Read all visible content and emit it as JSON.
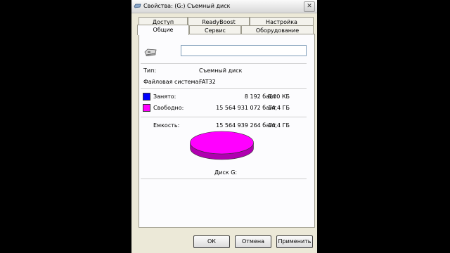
{
  "window": {
    "title": "Свойства: (G:) Съемный диск"
  },
  "tabs_back": [
    "Доступ",
    "ReadyBoost",
    "Настройка"
  ],
  "tabs_front": [
    "Общие",
    "Сервис",
    "Оборудование"
  ],
  "volume_label": "",
  "info": {
    "type_label": "Тип:",
    "type_value": "Съемный диск",
    "fs_label": "Файловая система:",
    "fs_value": "FAT32"
  },
  "usage": {
    "used_label": "Занято:",
    "used_bytes": "8 192 байт",
    "used_size": "8,00 КБ",
    "used_color": "#0000ff",
    "free_label": "Свободно:",
    "free_bytes": "15 564 931 072 байт",
    "free_size": "14,4 ГБ",
    "free_color": "#ff00ff",
    "capacity_label": "Емкость:",
    "capacity_bytes": "15 564 939 264 байт",
    "capacity_size": "14,4 ГБ"
  },
  "chart_data": {
    "type": "pie",
    "categories": [
      "Занято",
      "Свободно"
    ],
    "values": [
      8192,
      15564931072
    ],
    "colors": [
      "#0000ff",
      "#ff00ff"
    ],
    "title": "Диск G:"
  },
  "buttons": {
    "ok": "ОК",
    "cancel": "Отмена",
    "apply": "Применить"
  }
}
